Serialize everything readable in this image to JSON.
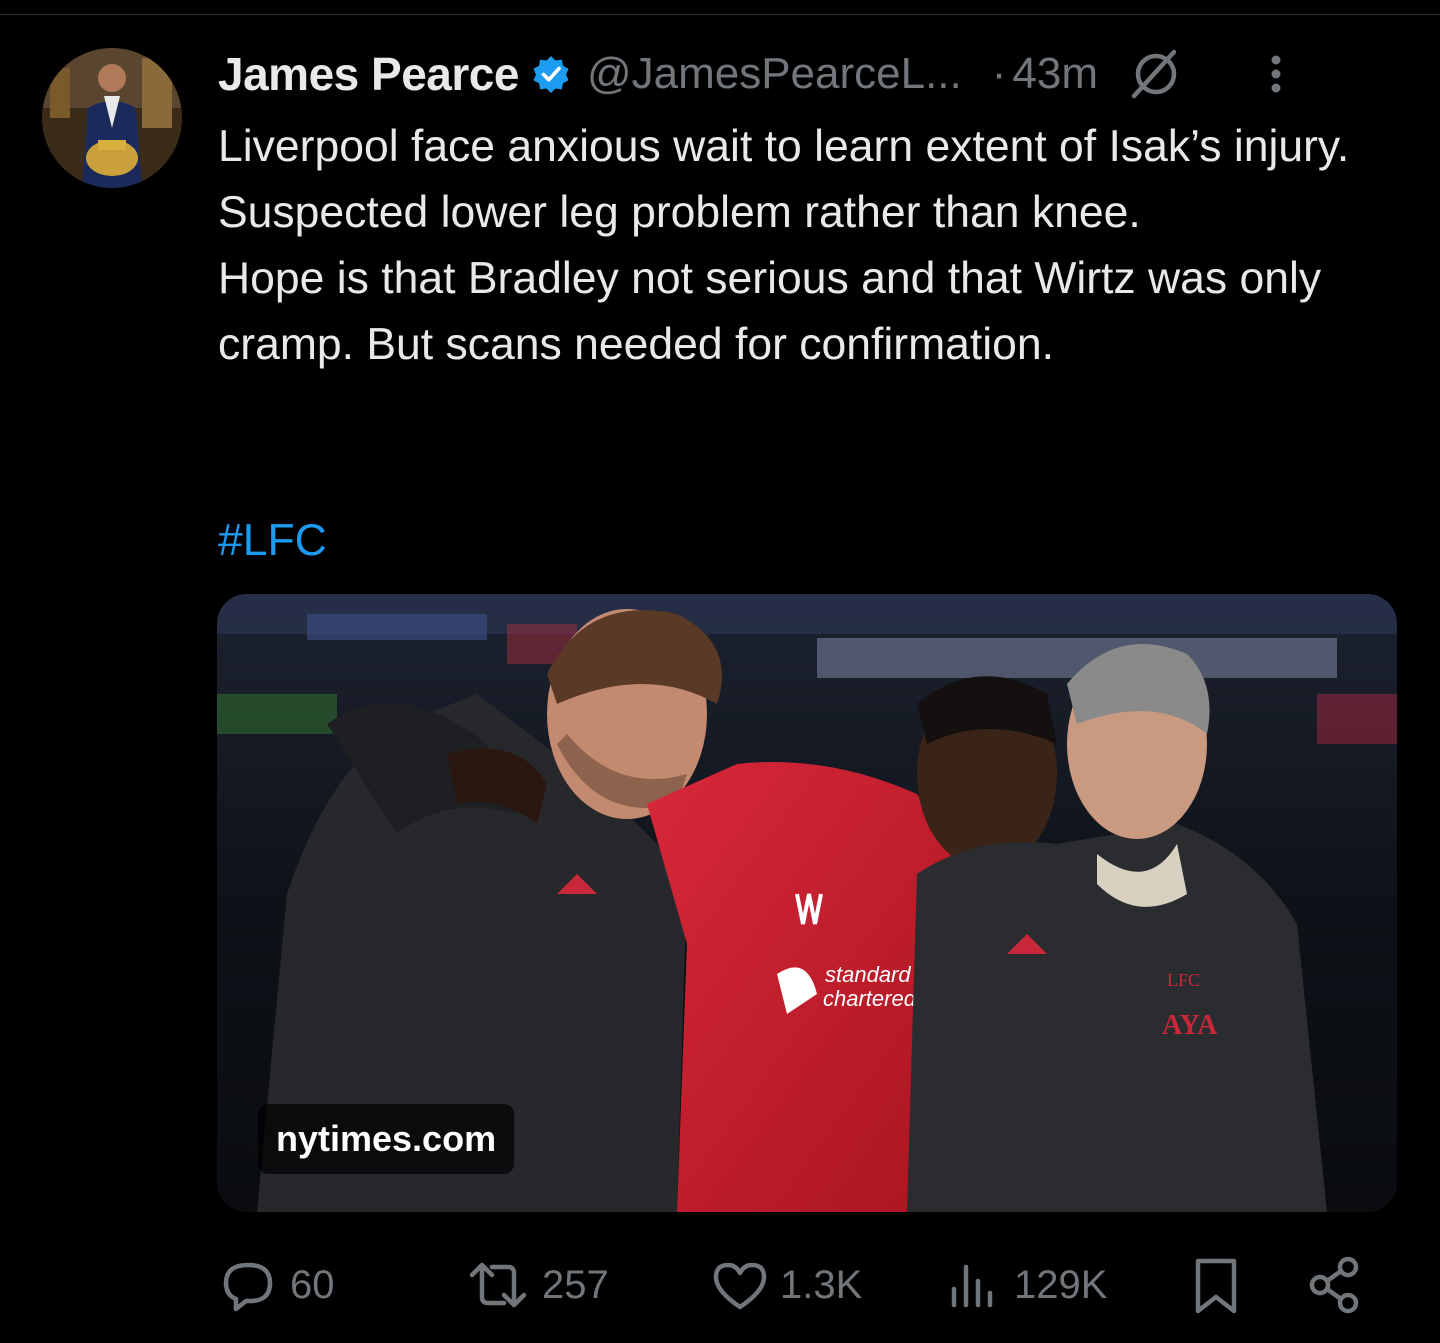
{
  "tweet": {
    "author_name": "James Pearce",
    "handle": "@JamesPearceL...",
    "separator": "·",
    "time": "43m",
    "text_lines": [
      "Liverpool face anxious wait to learn extent of Isak’s injury. Suspected lower leg problem rather than knee.",
      "Hope is that Bradley not serious and that Wirtz was only cramp. But scans needed for confirmation."
    ],
    "hashtag": "#LFC",
    "media": {
      "source": "nytimes.com",
      "shirt_sponsor": "standard chartered",
      "jacket_text": "LFC",
      "initials": "AYA"
    }
  },
  "actions": {
    "replies": "60",
    "reposts": "257",
    "likes": "1.3K",
    "views": "129K"
  },
  "colors": {
    "background": "#000000",
    "text": "#e7e9ea",
    "secondary": "#71767b",
    "link": "#1d9bf0",
    "verified": "#1d9bf0"
  },
  "icons": {
    "verified": "verified-badge-icon",
    "grok": "grok-icon",
    "more": "more-vertical-icon",
    "reply": "reply-icon",
    "repost": "repost-icon",
    "like": "heart-icon",
    "views": "views-icon",
    "bookmark": "bookmark-icon",
    "share": "share-icon"
  }
}
